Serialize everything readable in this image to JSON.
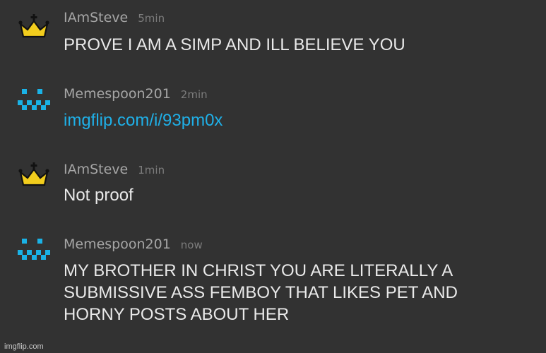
{
  "colors": {
    "background": "#323232",
    "username": "#a6a6a6",
    "timestamp": "#7c7c7c",
    "message_text": "#e9e9e9",
    "link": "#1fb0e8",
    "crown_gold": "#f2cd1d",
    "pixel_blue": "#1ab2e6"
  },
  "messages": [
    {
      "avatar_icon": "crown-icon",
      "username": "IAmSteve",
      "time": "5min",
      "text": "PROVE I AM A SIMP AND ILL BELIEVE YOU"
    },
    {
      "avatar_icon": "pixel-face-icon",
      "username": "Memespoon201",
      "time": "2min",
      "text": "imgflip.com/i/93pm0x"
    },
    {
      "avatar_icon": "crown-icon",
      "username": "IAmSteve",
      "time": "1min",
      "text": "Not proof"
    },
    {
      "avatar_icon": "pixel-face-icon",
      "username": "Memespoon201",
      "time": "now",
      "text": "MY BROTHER IN CHRIST YOU ARE LITERALLY A\nSUBMISSIVE ASS FEMBOY THAT LIKES PET AND\nHORNY POSTS ABOUT HER"
    }
  ],
  "watermark": "imgflip.com"
}
